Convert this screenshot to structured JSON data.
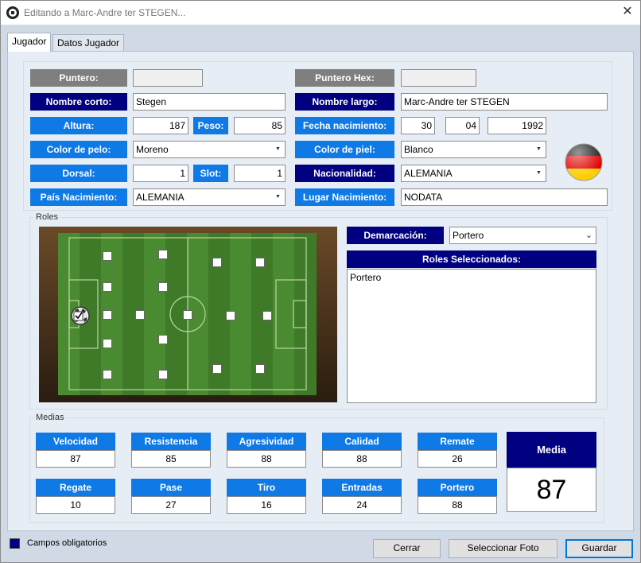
{
  "window": {
    "title": "Editando a Marc-Andre ter STEGEN...",
    "close_glyph": "✕"
  },
  "tabs": [
    {
      "label": "Jugador"
    },
    {
      "label": "Datos Jugador"
    }
  ],
  "form": {
    "puntero": {
      "label": "Puntero:",
      "value": ""
    },
    "puntero_hex": {
      "label": "Puntero Hex:",
      "value": ""
    },
    "nombre_corto": {
      "label": "Nombre corto:",
      "value": "Stegen"
    },
    "nombre_largo": {
      "label": "Nombre largo:",
      "value": "Marc-Andre ter STEGEN"
    },
    "altura": {
      "label": "Altura:",
      "value": "187"
    },
    "peso": {
      "label": "Peso:",
      "value": "85"
    },
    "fecha_nacimiento": {
      "label": "Fecha nacimiento:",
      "day": "30",
      "month": "04",
      "year": "1992"
    },
    "color_pelo": {
      "label": "Color de pelo:",
      "value": "Moreno"
    },
    "color_piel": {
      "label": "Color de piel:",
      "value": "Blanco"
    },
    "dorsal": {
      "label": "Dorsal:",
      "value": "1"
    },
    "slot": {
      "label": "Slot:",
      "value": "1"
    },
    "nacionalidad": {
      "label": "Nacionalidad:",
      "value": "ALEMANIA",
      "flag_icon": "germany-flag-icon"
    },
    "pais_nacimiento": {
      "label": "País Nacimiento:",
      "value": "ALEMANIA"
    },
    "lugar_nacimiento": {
      "label": "Lugar Nacimiento:",
      "value": "NODATA"
    }
  },
  "roles": {
    "group_title": "Roles",
    "demarcacion": {
      "label": "Demarcación:",
      "value": "Portero"
    },
    "seleccionados": {
      "header": "Roles Seleccionados:",
      "items": [
        "Portero"
      ]
    },
    "pitch_positions_checked": [
      "GK"
    ]
  },
  "medias": {
    "group_title": "Medias",
    "stats": [
      {
        "name": "Velocidad",
        "value": "87"
      },
      {
        "name": "Resistencia",
        "value": "85"
      },
      {
        "name": "Agresividad",
        "value": "88"
      },
      {
        "name": "Calidad",
        "value": "88"
      },
      {
        "name": "Remate",
        "value": "26"
      },
      {
        "name": "Regate",
        "value": "10"
      },
      {
        "name": "Pase",
        "value": "27"
      },
      {
        "name": "Tiro",
        "value": "16"
      },
      {
        "name": "Entradas",
        "value": "24"
      },
      {
        "name": "Portero",
        "value": "88"
      }
    ],
    "media": {
      "label": "Media",
      "value": "87"
    }
  },
  "footer": {
    "legend": "Campos obligatorios",
    "legend_color": "#000080",
    "buttons": {
      "cerrar": "Cerrar",
      "foto": "Seleccionar Foto",
      "guardar": "Guardar"
    }
  },
  "colors": {
    "navy": "#000080",
    "blue": "#0f7ae5",
    "gray": "#7f7f7f",
    "accent": "#0078d7"
  }
}
